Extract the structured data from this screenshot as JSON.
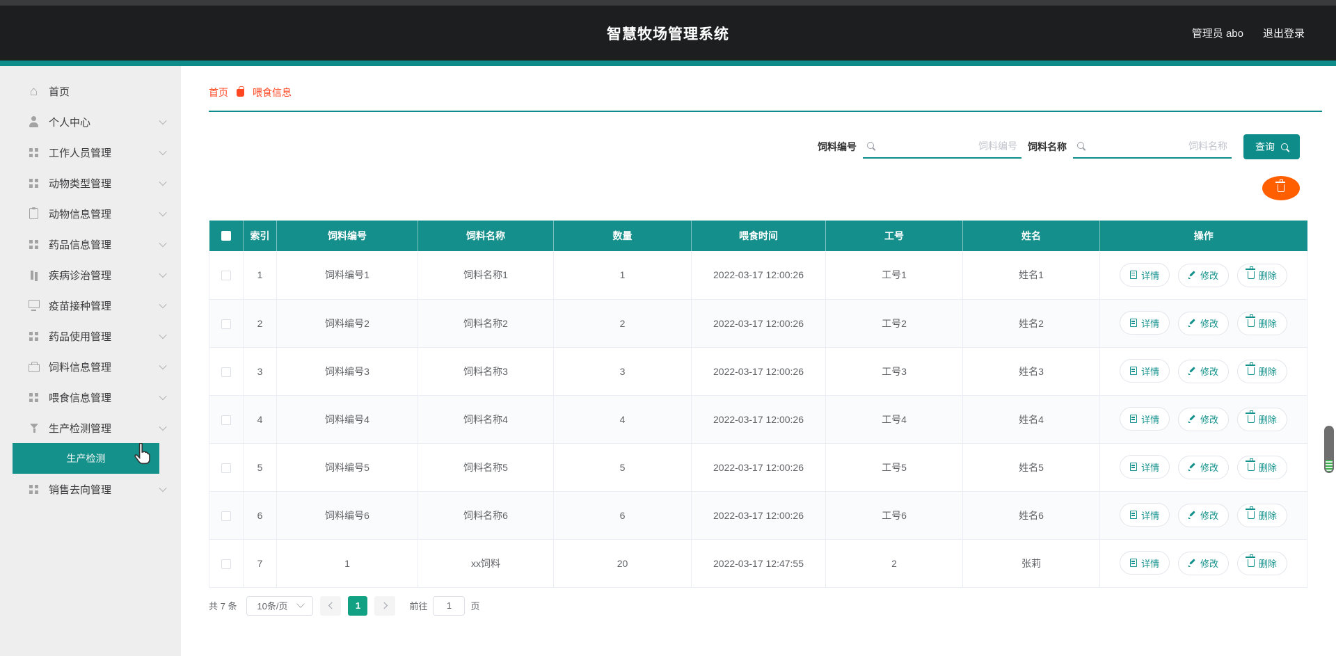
{
  "app": {
    "title": "智慧牧场管理系统",
    "user": "管理员 abo",
    "logout": "退出登录"
  },
  "breadcrumb": {
    "home": "首页",
    "current": "喂食信息"
  },
  "sidebar": {
    "items": [
      {
        "label": "首页",
        "icon": "home-icon",
        "expandable": false
      },
      {
        "label": "个人中心",
        "icon": "user-icon",
        "expandable": true
      },
      {
        "label": "工作人员管理",
        "icon": "grid-icon",
        "expandable": true
      },
      {
        "label": "动物类型管理",
        "icon": "grid-icon",
        "expandable": true
      },
      {
        "label": "动物信息管理",
        "icon": "clipboard-icon",
        "expandable": true
      },
      {
        "label": "药品信息管理",
        "icon": "grid-icon",
        "expandable": true
      },
      {
        "label": "疾病诊治管理",
        "icon": "book-icon",
        "expandable": true
      },
      {
        "label": "疫苗接种管理",
        "icon": "monitor-icon",
        "expandable": true
      },
      {
        "label": "药品使用管理",
        "icon": "grid-icon",
        "expandable": true
      },
      {
        "label": "饲料信息管理",
        "icon": "briefcase-icon",
        "expandable": true
      },
      {
        "label": "喂食信息管理",
        "icon": "grid-icon",
        "expandable": true
      },
      {
        "label": "生产检测管理",
        "icon": "funnel-icon",
        "expandable": true
      },
      {
        "label": "销售去向管理",
        "icon": "grid-icon",
        "expandable": true
      }
    ],
    "active_submenu": "生产检测"
  },
  "search": {
    "field1_label": "饲料编号",
    "field1_placeholder": "饲料编号",
    "field2_label": "饲料名称",
    "field2_placeholder": "饲料名称",
    "query_button": "查询"
  },
  "table": {
    "headers": [
      "索引",
      "饲料编号",
      "饲料名称",
      "数量",
      "喂食时间",
      "工号",
      "姓名",
      "操作"
    ],
    "rows": [
      {
        "index": "1",
        "feed_no": "饲料编号1",
        "feed_name": "饲料名称1",
        "quantity": "1",
        "time": "2022-03-17 12:00:26",
        "worker_no": "工号1",
        "name": "姓名1"
      },
      {
        "index": "2",
        "feed_no": "饲料编号2",
        "feed_name": "饲料名称2",
        "quantity": "2",
        "time": "2022-03-17 12:00:26",
        "worker_no": "工号2",
        "name": "姓名2"
      },
      {
        "index": "3",
        "feed_no": "饲料编号3",
        "feed_name": "饲料名称3",
        "quantity": "3",
        "time": "2022-03-17 12:00:26",
        "worker_no": "工号3",
        "name": "姓名3"
      },
      {
        "index": "4",
        "feed_no": "饲料编号4",
        "feed_name": "饲料名称4",
        "quantity": "4",
        "time": "2022-03-17 12:00:26",
        "worker_no": "工号4",
        "name": "姓名4"
      },
      {
        "index": "5",
        "feed_no": "饲料编号5",
        "feed_name": "饲料名称5",
        "quantity": "5",
        "time": "2022-03-17 12:00:26",
        "worker_no": "工号5",
        "name": "姓名5"
      },
      {
        "index": "6",
        "feed_no": "饲料编号6",
        "feed_name": "饲料名称6",
        "quantity": "6",
        "time": "2022-03-17 12:00:26",
        "worker_no": "工号6",
        "name": "姓名6"
      },
      {
        "index": "7",
        "feed_no": "1",
        "feed_name": "xx饲料",
        "quantity": "20",
        "time": "2022-03-17 12:47:55",
        "worker_no": "2",
        "name": "张莉"
      }
    ],
    "actions": {
      "detail": "详情",
      "edit": "修改",
      "delete": "删除"
    }
  },
  "pagination": {
    "total": "共 7 条",
    "page_size": "10条/页",
    "active_page": "1",
    "goto_label": "前往",
    "goto_value": "1",
    "page_unit": "页"
  },
  "colors": {
    "teal_accent": "#0e8c89",
    "table_header_bg": "#148f8b",
    "sidebar_selected_bg": "#15918b",
    "breadcrumb_text": "#ff4722",
    "orange_button": "#ff5f00",
    "pager_active_bg": "#12a182",
    "topbar_bg": "#1d1e20"
  }
}
